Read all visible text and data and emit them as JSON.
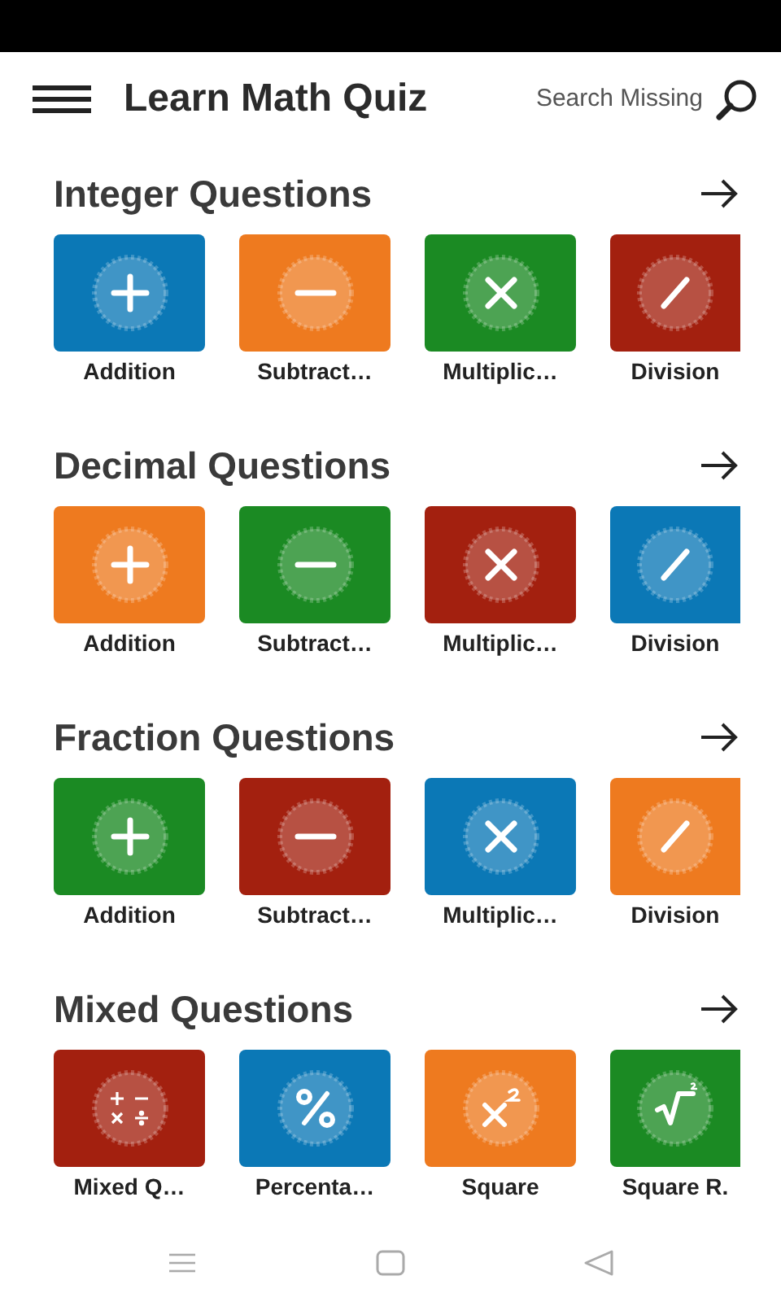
{
  "app_bar": {
    "title": "Learn Math Quiz",
    "search_label": "Search Missing"
  },
  "sections": [
    {
      "title": "Integer Questions",
      "tiles": [
        {
          "label": "Addition",
          "kind": "plus",
          "color": "#0b78b6"
        },
        {
          "label": "Subtract…",
          "kind": "minus",
          "color": "#ee7a1f"
        },
        {
          "label": "Multiplic…",
          "kind": "times",
          "color": "#1b8a23"
        },
        {
          "label": "Division",
          "kind": "divide",
          "color": "#a3200f"
        }
      ]
    },
    {
      "title": "Decimal Questions",
      "tiles": [
        {
          "label": "Addition",
          "kind": "plus",
          "color": "#ee7a1f"
        },
        {
          "label": "Subtract…",
          "kind": "minus",
          "color": "#1b8a23"
        },
        {
          "label": "Multiplic…",
          "kind": "times",
          "color": "#a3200f"
        },
        {
          "label": "Division",
          "kind": "divide",
          "color": "#0b78b6"
        }
      ]
    },
    {
      "title": "Fraction Questions",
      "tiles": [
        {
          "label": "Addition",
          "kind": "plus",
          "color": "#1b8a23"
        },
        {
          "label": "Subtract…",
          "kind": "minus",
          "color": "#a3200f"
        },
        {
          "label": "Multiplic…",
          "kind": "times",
          "color": "#0b78b6"
        },
        {
          "label": "Division",
          "kind": "divide",
          "color": "#ee7a1f"
        }
      ]
    },
    {
      "title": "Mixed Questions",
      "tiles": [
        {
          "label": "Mixed Q…",
          "kind": "mixed",
          "color": "#a3200f"
        },
        {
          "label": "Percenta…",
          "kind": "percent",
          "color": "#0b78b6"
        },
        {
          "label": "Square",
          "kind": "square",
          "color": "#ee7a1f"
        },
        {
          "label": "Square R.",
          "kind": "sqrt",
          "color": "#1b8a23"
        }
      ]
    }
  ]
}
